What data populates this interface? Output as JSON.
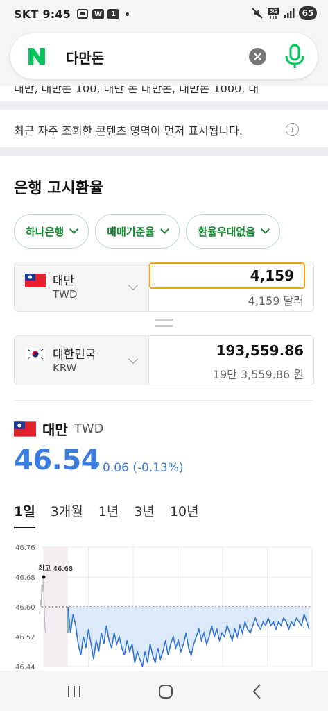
{
  "status_bar": {
    "carrier": "SKT",
    "time": "9:45",
    "icon_w": "W",
    "icon_1": "1",
    "battery": "65"
  },
  "search": {
    "query": "다만돈",
    "logo_letter": "N"
  },
  "cut_text": "대만, 대만돈 100, 대만 돈 대만돈, 대만돈 1000, 대",
  "notice": {
    "text": "최근 자주 조회한 콘텐츠 영역이 먼저 표시됩니다.",
    "info": "i"
  },
  "section_title": "은행 고시환율",
  "chips": [
    {
      "label": "하나은행"
    },
    {
      "label": "매매기준율"
    },
    {
      "label": "환율우대없음"
    }
  ],
  "converter": {
    "from": {
      "name": "대만",
      "code": "TWD",
      "value": "4,159",
      "sub": "4,159 달러"
    },
    "to": {
      "name": "대한민국",
      "code": "KRW",
      "value": "193,559.86",
      "sub": "19만 3,559.86 원"
    }
  },
  "rate": {
    "name": "대만",
    "code": "TWD",
    "value": "46.54",
    "change": "0.06 (-0.13%)"
  },
  "period_tabs": [
    {
      "label": "1일",
      "active": true
    },
    {
      "label": "3개월",
      "active": false
    },
    {
      "label": "1년",
      "active": false
    },
    {
      "label": "3년",
      "active": false
    },
    {
      "label": "10년",
      "active": false
    }
  ],
  "chart_data": {
    "type": "line",
    "y_ticks": [
      "46.76",
      "46.68",
      "46.60",
      "46.52",
      "46.44"
    ],
    "ylim": [
      46.44,
      46.76
    ],
    "high_label": "최고 46.68",
    "high_value": 46.68,
    "reference_value": 46.6,
    "series_color": "#2f73d9",
    "fill_color": "#dbe9fb",
    "pre_market_values": [
      46.58,
      46.62,
      46.6,
      46.66,
      46.64,
      46.68,
      46.62,
      46.55,
      46.53
    ],
    "values": [
      46.6,
      46.53,
      46.58,
      46.55,
      46.5,
      46.47,
      46.52,
      46.49,
      46.54,
      46.5,
      46.46,
      46.51,
      46.48,
      46.53,
      46.5,
      46.55,
      46.51,
      46.49,
      46.53,
      46.5,
      46.52,
      46.49,
      46.47,
      46.51,
      46.48,
      46.5,
      46.45,
      46.48,
      46.46,
      46.44,
      46.48,
      46.45,
      46.5,
      46.47,
      46.45,
      46.49,
      46.46,
      46.48,
      46.51,
      46.47,
      46.5,
      46.52,
      46.49,
      46.51,
      46.48,
      46.5,
      46.53,
      46.49,
      46.47,
      46.5,
      46.52,
      46.54,
      46.51,
      46.53,
      46.5,
      46.52,
      46.55,
      46.52,
      46.54,
      46.51,
      46.53,
      46.52,
      46.55,
      46.53,
      46.51,
      46.54,
      46.52,
      46.55,
      46.53,
      46.56,
      46.54,
      46.53,
      46.55,
      46.57,
      46.55,
      46.54,
      46.56,
      46.55,
      46.57,
      46.55,
      46.56,
      46.54,
      46.56,
      46.55,
      46.57,
      46.56,
      46.54,
      46.56,
      46.55,
      46.57,
      46.56,
      46.55,
      46.58,
      46.56,
      46.54
    ]
  },
  "colors": {
    "accent_blue": "#3b7ee0",
    "naver_green": "#03c75a",
    "chip_green": "#108a2d",
    "input_border": "#f0a312"
  },
  "icons": {
    "clear": "clear-icon",
    "mic": "mic-icon",
    "info": "info-icon",
    "nav_recent": "recent-apps-icon",
    "nav_home": "home-icon",
    "nav_back": "back-icon"
  }
}
